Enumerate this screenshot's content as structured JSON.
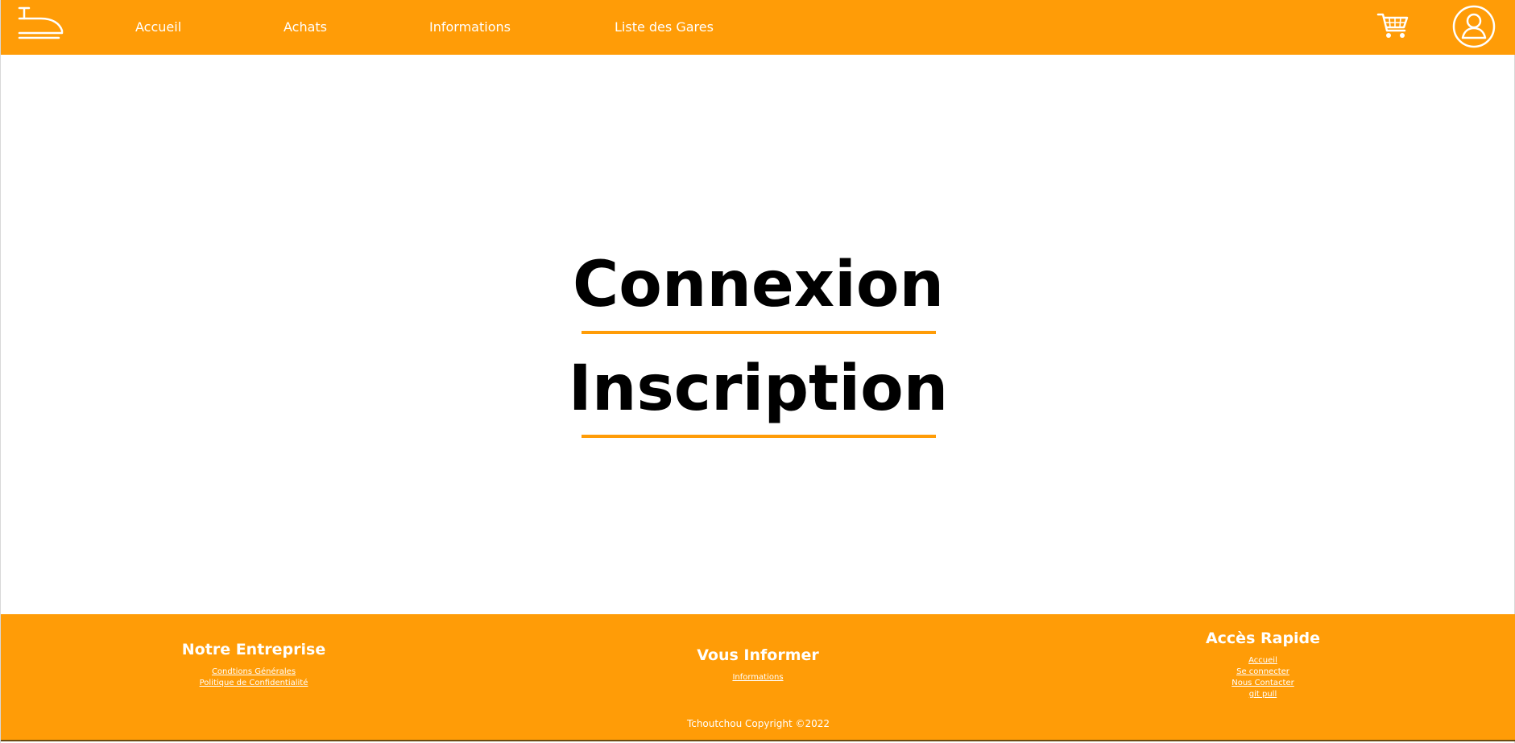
{
  "colors": {
    "brand": "#ff9c07",
    "text_main": "#000000",
    "text_light": "#ffffff"
  },
  "header": {
    "logo_icon": "train-icon",
    "nav": [
      {
        "label": "Accueil"
      },
      {
        "label": "Achats"
      },
      {
        "label": "Informations"
      },
      {
        "label": "Liste des Gares"
      }
    ],
    "cart_icon": "shopping-cart-icon",
    "account_icon": "user-circle-icon"
  },
  "main": {
    "options": [
      {
        "label": "Connexion"
      },
      {
        "label": "Inscription"
      }
    ]
  },
  "footer": {
    "columns": [
      {
        "title": "Notre Entreprise",
        "links": [
          "Condtions Générales",
          "Politique de Confidentialité"
        ]
      },
      {
        "title": "Vous Informer",
        "links": [
          "Informations"
        ]
      },
      {
        "title": "Accès Rapide",
        "links": [
          "Accueil",
          "Se connecter",
          "Nous Contacter",
          "git pull"
        ]
      }
    ],
    "copyright": "Tchoutchou Copyright ©2022"
  }
}
